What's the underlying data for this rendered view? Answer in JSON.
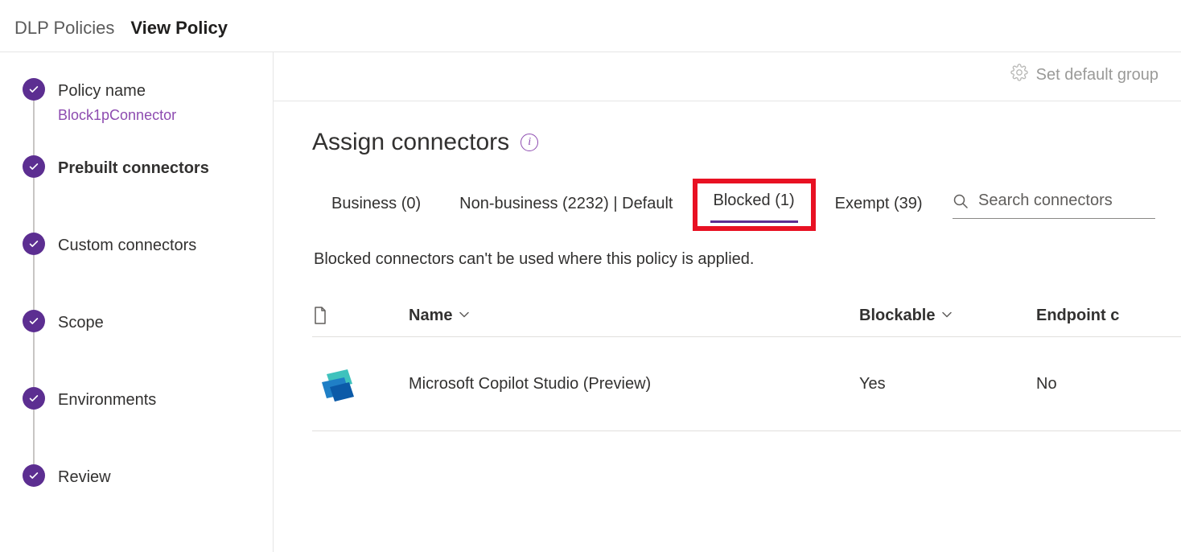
{
  "breadcrumb": {
    "parent": "DLP Policies",
    "current": "View Policy"
  },
  "stepper": {
    "items": [
      {
        "label": "Policy name",
        "sub": "Block1pConnector"
      },
      {
        "label": "Prebuilt connectors"
      },
      {
        "label": "Custom connectors"
      },
      {
        "label": "Scope"
      },
      {
        "label": "Environments"
      },
      {
        "label": "Review"
      }
    ]
  },
  "topbar": {
    "set_default_label": "Set default group"
  },
  "section": {
    "title": "Assign connectors"
  },
  "tabs": {
    "business": "Business (0)",
    "nonbusiness": "Non-business (2232) | Default",
    "blocked": "Blocked (1)",
    "exempt": "Exempt (39)"
  },
  "search": {
    "placeholder": "Search connectors"
  },
  "tab_description": "Blocked connectors can't be used where this policy is applied.",
  "table": {
    "headers": {
      "name": "Name",
      "blockable": "Blockable",
      "endpoint": "Endpoint c"
    },
    "rows": [
      {
        "name": "Microsoft Copilot Studio (Preview)",
        "blockable": "Yes",
        "endpoint": "No"
      }
    ]
  }
}
